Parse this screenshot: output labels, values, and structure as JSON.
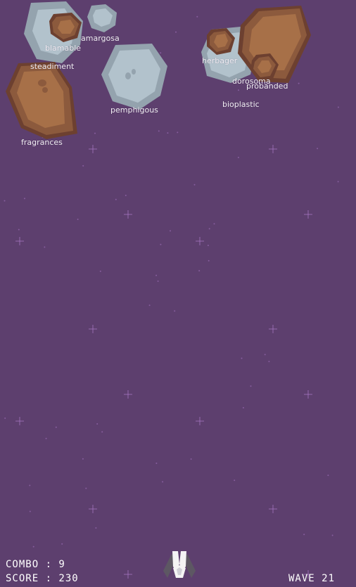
{
  "colors": {
    "background": "#5d3f6e",
    "star": "#a877c4",
    "rock_brown": "#8c5a3d",
    "rock_brown_light": "#a77048",
    "rock_grey": "#94a3ae",
    "rock_grey_light": "#b2c2cc"
  },
  "asteroids": [
    {
      "word": "amargosa",
      "kind": "grey"
    },
    {
      "word": "blamable",
      "kind": "brown"
    },
    {
      "word": "steadiment",
      "kind": "grey"
    },
    {
      "word": "fragrances",
      "kind": "brown"
    },
    {
      "word": "pemphigous",
      "kind": "grey"
    },
    {
      "word": "herbager",
      "kind": "brown"
    },
    {
      "word": "dorosoma",
      "kind": "grey"
    },
    {
      "word": "probanded",
      "kind": "brown"
    },
    {
      "word": "bioplastic",
      "kind": "brown"
    }
  ],
  "hud": {
    "combo_text": "COMBO : 9",
    "score_text": "SCORE : 230",
    "wave_text": "WAVE 21",
    "combo": 9,
    "score": 230,
    "wave": 21
  }
}
